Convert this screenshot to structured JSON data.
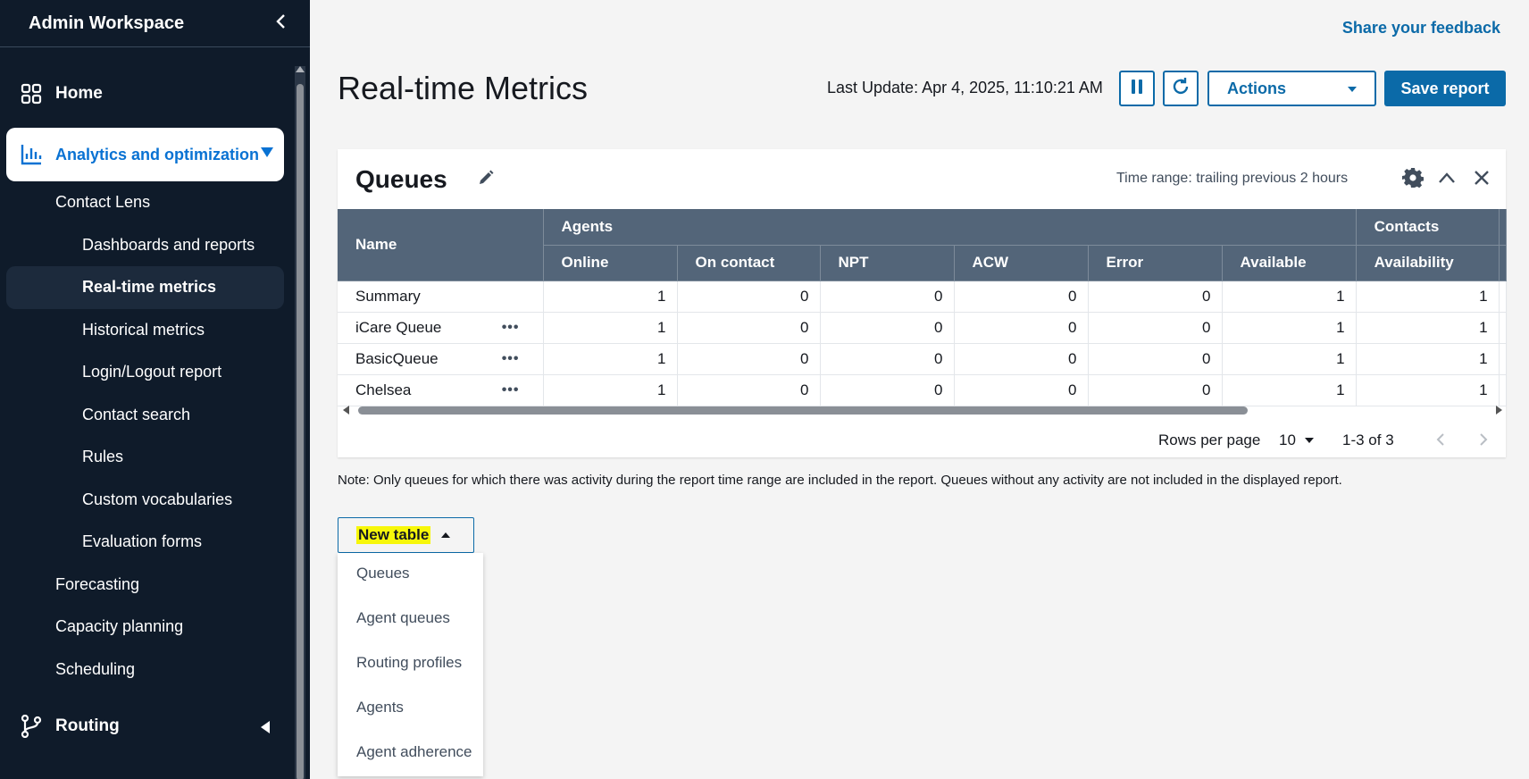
{
  "sidebar": {
    "title": "Admin Workspace",
    "home_label": "Home",
    "analytics_label": "Analytics and optimization",
    "contact_lens_label": "Contact Lens",
    "dashboards_label": "Dashboards and reports",
    "realtime_label": "Real-time metrics",
    "historical_label": "Historical metrics",
    "login_logout_label": "Login/Logout report",
    "contact_search_label": "Contact search",
    "rules_label": "Rules",
    "custom_vocab_label": "Custom vocabularies",
    "eval_forms_label": "Evaluation forms",
    "forecasting_label": "Forecasting",
    "capacity_label": "Capacity planning",
    "scheduling_label": "Scheduling",
    "routing_label": "Routing"
  },
  "header": {
    "feedback_label": "Share your feedback",
    "page_title": "Real-time Metrics",
    "last_update": "Last Update: Apr 4, 2025, 11:10:21 AM",
    "actions_label": "Actions",
    "save_label": "Save report"
  },
  "card": {
    "title": "Queues",
    "time_range": "Time range: trailing previous 2 hours",
    "groups": {
      "name": "Name",
      "agents": "Agents",
      "contacts": "Contacts"
    },
    "columns": [
      "Online",
      "On contact",
      "NPT",
      "ACW",
      "Error",
      "Available",
      "Availability"
    ],
    "rows": [
      {
        "name": "Summary",
        "values": [
          "1",
          "0",
          "0",
          "0",
          "0",
          "1",
          "1"
        ]
      },
      {
        "name": "iCare Queue",
        "values": [
          "1",
          "0",
          "0",
          "0",
          "0",
          "1",
          "1"
        ]
      },
      {
        "name": "BasicQueue",
        "values": [
          "1",
          "0",
          "0",
          "0",
          "0",
          "1",
          "1"
        ]
      },
      {
        "name": "Chelsea",
        "values": [
          "1",
          "0",
          "0",
          "0",
          "0",
          "1",
          "1"
        ]
      }
    ],
    "rows_per_page_label": "Rows per page",
    "rows_per_page_value": "10",
    "range_label": "1-3 of 3",
    "row_menu_glyph": "•••"
  },
  "note": "Note: Only queues for which there was activity during the report time range are included in the report. Queues without any activity are not included in the displayed report.",
  "new_table": {
    "label": "New table",
    "menu": [
      "Queues",
      "Agent queues",
      "Routing profiles",
      "Agents",
      "Agent adherence"
    ]
  },
  "colors": {
    "sidebar_bg": "#0f1b2a",
    "accent": "#0b6aa8",
    "table_header": "#536579",
    "highlight": "#f7f70a"
  },
  "icons": {
    "home": "grid-icon",
    "analytics": "bar-chart-icon",
    "routing": "branch-icon",
    "pause": "pause-icon",
    "refresh": "refresh-icon",
    "settings": "gear-icon",
    "collapse": "chevron-up-icon",
    "close": "close-icon",
    "edit": "pencil-icon"
  }
}
